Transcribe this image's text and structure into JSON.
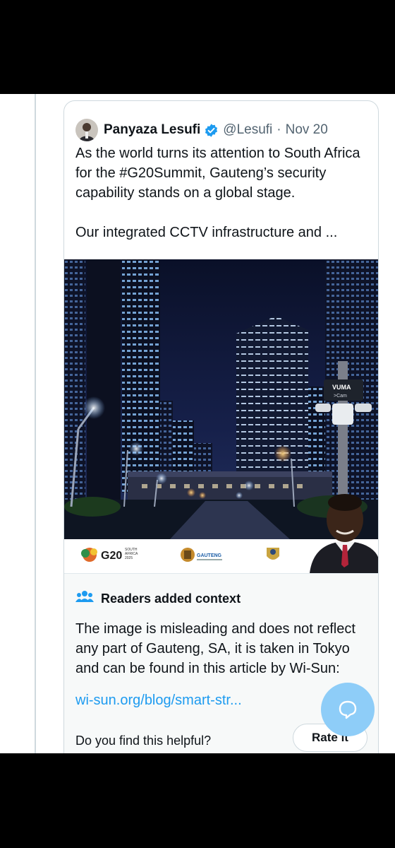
{
  "post": {
    "author_name": "Panyaza Lesufi",
    "handle": "@Lesufi",
    "separator": "·",
    "date": "Nov 20",
    "text": "As the world turns its attention to South Africa for the #G20Summit, Gauteng’s security capability stands on a global stage.\n\nOur integrated CCTV infrastructure and ..."
  },
  "media": {
    "camera_brand": "VUMA",
    "camera_sub": ">Cam",
    "g20_label": "G20",
    "g20_sub_1": "SOUTH",
    "g20_sub_2": "AFRICA",
    "g20_sub_3": "2025",
    "gauteng_label": "GAUTENG"
  },
  "context": {
    "title": "Readers added context",
    "body": "The image is misleading and does not reflect any part of Gauteng, SA, it is taken in Tokyo and can be found in this article by Wi-Sun:",
    "link": "wi-sun.org/blog/smart-str...",
    "question": "Do you find this helpful?",
    "rate_label": "Rate it"
  },
  "colors": {
    "accent": "#1d9bf0",
    "fab": "#8ecdf8",
    "verified": "#1d9bf0"
  },
  "icons": {
    "verified": "verified-badge-icon",
    "readers": "people-group-icon",
    "compose": "chat-bubble-icon"
  }
}
